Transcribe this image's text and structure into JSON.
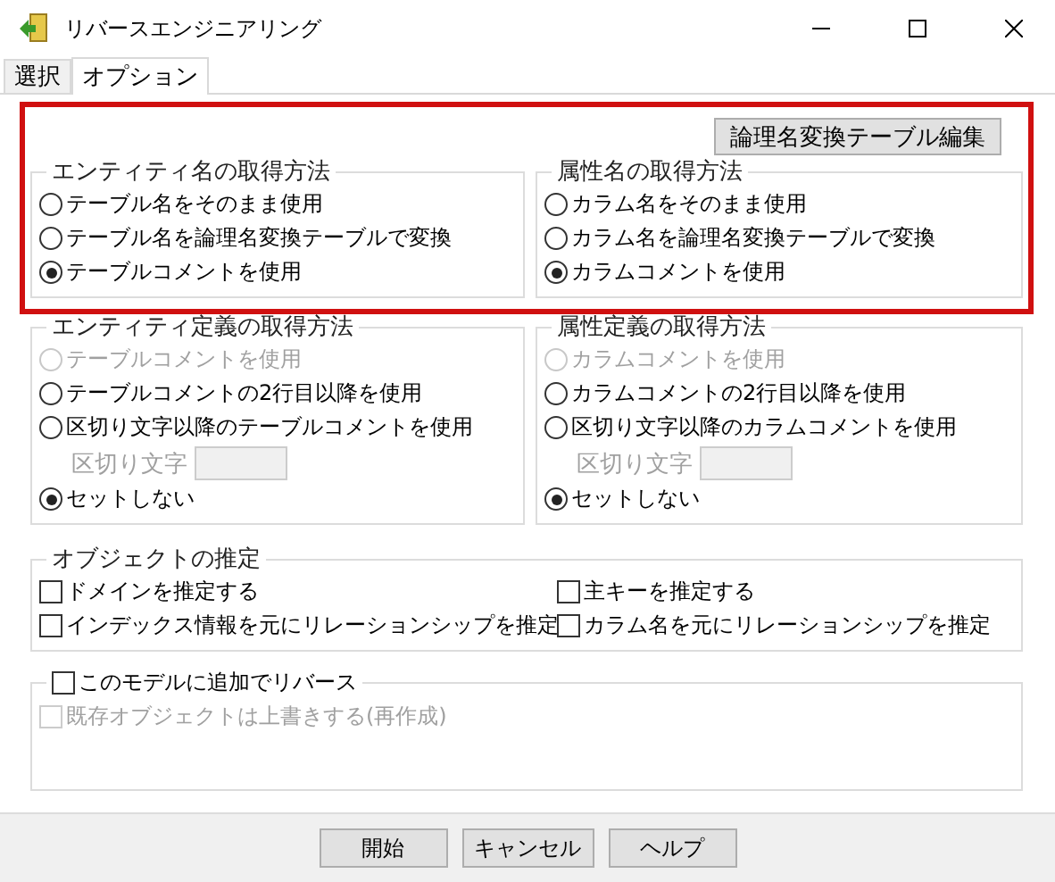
{
  "window": {
    "title": "リバースエンジニアリング"
  },
  "tabs": [
    {
      "label": "選択",
      "selected": false
    },
    {
      "label": "オプション",
      "selected": true
    }
  ],
  "highlight": {
    "on": true
  },
  "edit_button": "論理名変換テーブル編集",
  "name_groups": [
    {
      "title": "エンティティ名の取得方法",
      "options": [
        {
          "label": "テーブル名をそのまま使用",
          "selected": false
        },
        {
          "label": "テーブル名を論理名変換テーブルで変換",
          "selected": false
        },
        {
          "label": "テーブルコメントを使用",
          "selected": true
        }
      ]
    },
    {
      "title": "属性名の取得方法",
      "options": [
        {
          "label": "カラム名をそのまま使用",
          "selected": false
        },
        {
          "label": "カラム名を論理名変換テーブルで変換",
          "selected": false
        },
        {
          "label": "カラムコメントを使用",
          "selected": true
        }
      ]
    }
  ],
  "definition_groups": [
    {
      "title": "エンティティ定義の取得方法",
      "options": [
        {
          "kind": "radio",
          "label": "テーブルコメントを使用",
          "selected": false,
          "disabled": true
        },
        {
          "kind": "radio",
          "label": "テーブルコメントの2行目以降を使用",
          "selected": false,
          "disabled": false
        },
        {
          "kind": "radio",
          "label": "区切り文字以降のテーブルコメントを使用",
          "selected": false,
          "disabled": false
        },
        {
          "kind": "field",
          "label": "区切り文字",
          "disabled": true
        },
        {
          "kind": "radio",
          "label": "セットしない",
          "selected": true,
          "disabled": false
        }
      ]
    },
    {
      "title": "属性定義の取得方法",
      "options": [
        {
          "kind": "radio",
          "label": "カラムコメントを使用",
          "selected": false,
          "disabled": true
        },
        {
          "kind": "radio",
          "label": "カラムコメントの2行目以降を使用",
          "selected": false,
          "disabled": false
        },
        {
          "kind": "radio",
          "label": "区切り文字以降のカラムコメントを使用",
          "selected": false,
          "disabled": false
        },
        {
          "kind": "field",
          "label": "区切り文字",
          "disabled": true
        },
        {
          "kind": "radio",
          "label": "セットしない",
          "selected": true,
          "disabled": false
        }
      ]
    }
  ],
  "estimation": {
    "title": "オブジェクトの推定",
    "checkboxes": [
      {
        "label": "ドメインを推定する",
        "checked": false
      },
      {
        "label": "主キーを推定する",
        "checked": false
      },
      {
        "label": "インデックス情報を元にリレーションシップを推定",
        "checked": false
      },
      {
        "label": "カラム名を元にリレーションシップを推定",
        "checked": false
      }
    ]
  },
  "model_group": {
    "title": {
      "label": "このモデルに追加でリバース",
      "checked": false
    },
    "options": [
      {
        "label": "既存オブジェクトは上書きする(再作成)",
        "checked": false,
        "disabled": true
      }
    ]
  },
  "buttons": [
    "開始",
    "キャンセル",
    "ヘルプ"
  ]
}
